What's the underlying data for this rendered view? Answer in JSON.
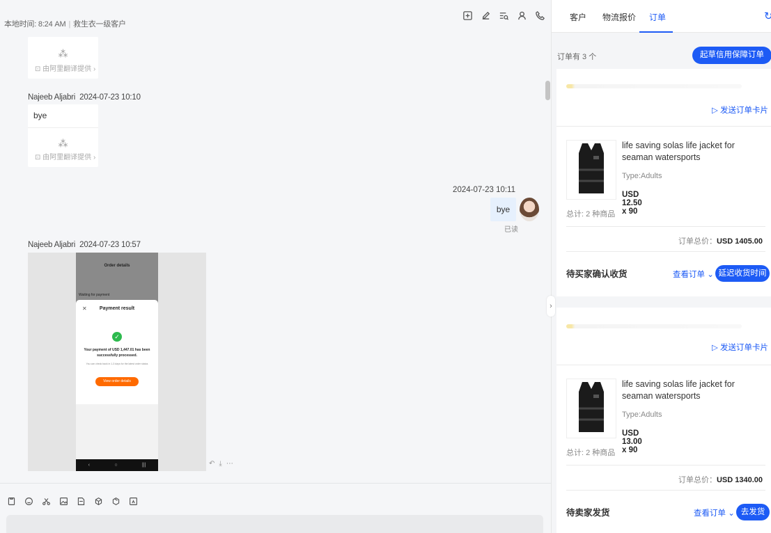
{
  "header": {
    "local_time": "本地时间: 8:24 AM",
    "customer_tag": "救生衣一级客户"
  },
  "messages": {
    "translate_provider": "由阿里翻译提供",
    "msg1": {
      "sender": "Najeeb Aljabri",
      "time": "2024-07-23 10:10",
      "text": "bye"
    },
    "my_msg": {
      "time": "2024-07-23 10:11",
      "text": "bye",
      "read": "已读"
    },
    "msg2": {
      "sender": "Najeeb Aljabri",
      "time": "2024-07-23 10:57"
    }
  },
  "screenshot": {
    "title": "Order details",
    "waiting": "Waiting for payment",
    "modal_title": "Payment result",
    "message": "Your payment of USD 1,447.01 has been successfully processed.",
    "note": "You can check back in 1-3 days for the latest order status",
    "button": "View order details"
  },
  "tabs": [
    "客户",
    "物流报价",
    "订单"
  ],
  "orders_panel": {
    "count": "订单有 3 个",
    "draft_button": "起草信用保障订单",
    "send_card": "发送订单卡片",
    "view_order": "查看订单",
    "total_label": "订单总价："
  },
  "orders": [
    {
      "product": "life saving solas life jacket for seaman watersports",
      "type": "Type:Adults",
      "price": "USD 12.50 x 90",
      "items_total": "总计: 2 种商品",
      "total": "USD 1405.00",
      "status": "待买家确认收货",
      "action": "延迟收货时间"
    },
    {
      "product": "life saving solas life jacket for seaman watersports",
      "type": "Type:Adults",
      "price": "USD 13.00 x 90",
      "items_total": "总计: 2 种商品",
      "total": "USD 1340.00",
      "status": "待卖家发货",
      "action": "去发货"
    }
  ],
  "colors": {
    "accent": "#1d5bf5",
    "bubble_mine": "#e6f0fd",
    "payment_button": "#ff6a00",
    "success": "#2dba4e"
  }
}
